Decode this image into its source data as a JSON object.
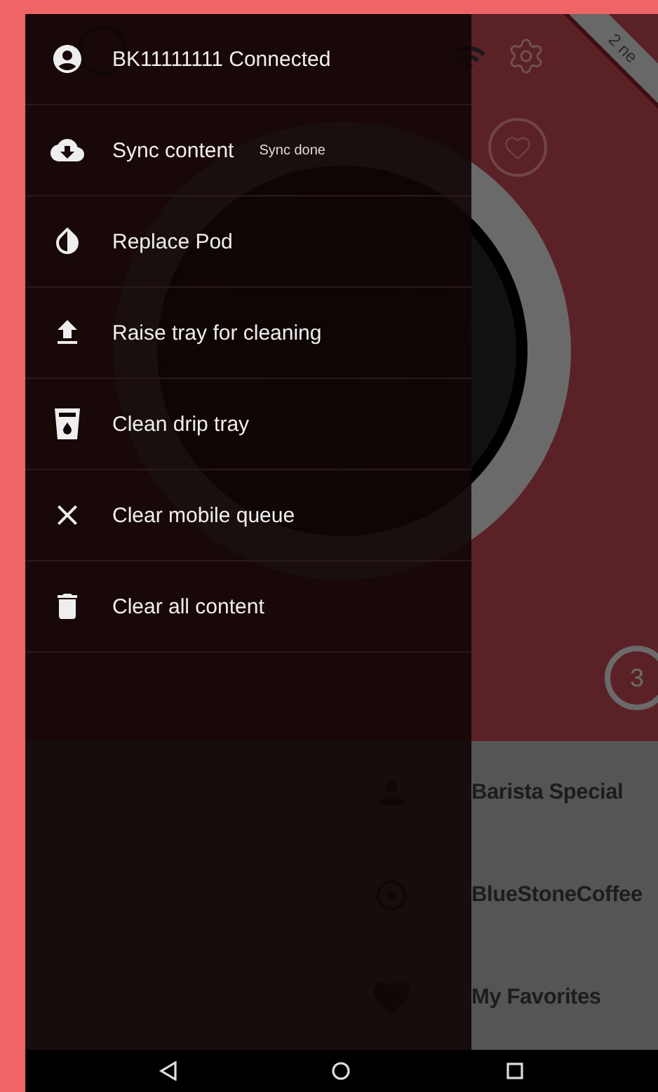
{
  "app": {
    "ribbon": "2 ne",
    "badge": "3",
    "categories": [
      {
        "label": "Barista Special"
      },
      {
        "label": "BlueStoneCoffee"
      },
      {
        "label": "My Favorites"
      }
    ]
  },
  "drawer": {
    "items": [
      {
        "label": "BK11111111 Connected"
      },
      {
        "label": "Sync content",
        "status": "Sync done"
      },
      {
        "label": "Replace Pod"
      },
      {
        "label": "Raise tray for cleaning"
      },
      {
        "label": "Clean drip tray"
      },
      {
        "label": "Clear mobile queue"
      },
      {
        "label": "Clear all content"
      }
    ]
  }
}
